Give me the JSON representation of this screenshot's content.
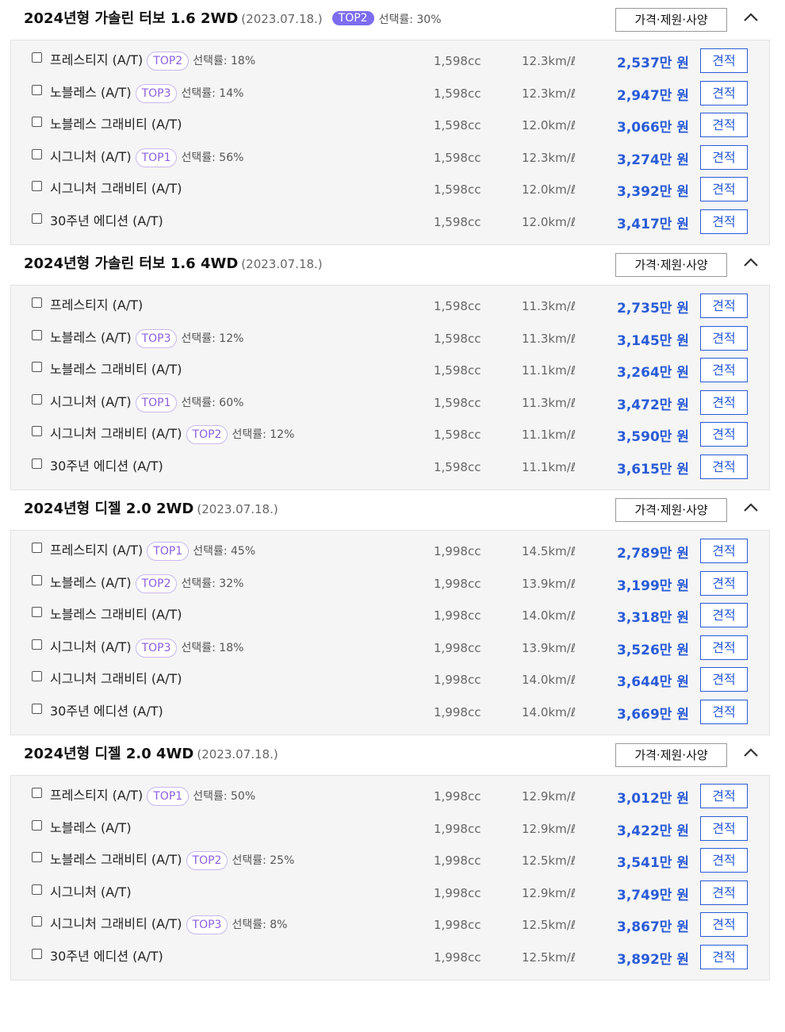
{
  "ui": {
    "spec_label": "가격·제원·사양",
    "quote_label": "견적",
    "icons": {
      "collapse": "chevron-up-icon",
      "checkbox": "checkbox-icon"
    },
    "colors": {
      "price": "#2a5bd7",
      "badge": "#8c5fe0",
      "top_badge_fill": "#7b6cf0"
    }
  },
  "groups": [
    {
      "title": "2024년형 가솔린 터보 1.6 2WD",
      "date": "(2023.07.18.)",
      "top": "TOP2",
      "rate": "선택률: 30%",
      "rows": [
        {
          "name": "프레스티지 (A/T)",
          "top": "TOP2",
          "rate": "선택률: 18%",
          "cc": "1,598cc",
          "eff": "12.3km/ℓ",
          "price": "2,537만 원"
        },
        {
          "name": "노블레스 (A/T)",
          "top": "TOP3",
          "rate": "선택률: 14%",
          "cc": "1,598cc",
          "eff": "12.3km/ℓ",
          "price": "2,947만 원"
        },
        {
          "name": "노블레스 그래비티 (A/T)",
          "top": "",
          "rate": "",
          "cc": "1,598cc",
          "eff": "12.0km/ℓ",
          "price": "3,066만 원"
        },
        {
          "name": "시그니처 (A/T)",
          "top": "TOP1",
          "rate": "선택률: 56%",
          "cc": "1,598cc",
          "eff": "12.3km/ℓ",
          "price": "3,274만 원"
        },
        {
          "name": "시그니처 그래비티 (A/T)",
          "top": "",
          "rate": "",
          "cc": "1,598cc",
          "eff": "12.0km/ℓ",
          "price": "3,392만 원"
        },
        {
          "name": "30주년 에디션 (A/T)",
          "top": "",
          "rate": "",
          "cc": "1,598cc",
          "eff": "12.0km/ℓ",
          "price": "3,417만 원"
        }
      ]
    },
    {
      "title": "2024년형 가솔린 터보 1.6 4WD",
      "date": "(2023.07.18.)",
      "top": "",
      "rate": "",
      "rows": [
        {
          "name": "프레스티지 (A/T)",
          "top": "",
          "rate": "",
          "cc": "1,598cc",
          "eff": "11.3km/ℓ",
          "price": "2,735만 원"
        },
        {
          "name": "노블레스 (A/T)",
          "top": "TOP3",
          "rate": "선택률: 12%",
          "cc": "1,598cc",
          "eff": "11.3km/ℓ",
          "price": "3,145만 원"
        },
        {
          "name": "노블레스 그래비티 (A/T)",
          "top": "",
          "rate": "",
          "cc": "1,598cc",
          "eff": "11.1km/ℓ",
          "price": "3,264만 원"
        },
        {
          "name": "시그니처 (A/T)",
          "top": "TOP1",
          "rate": "선택률: 60%",
          "cc": "1,598cc",
          "eff": "11.3km/ℓ",
          "price": "3,472만 원"
        },
        {
          "name": "시그니처 그래비티 (A/T)",
          "top": "TOP2",
          "rate": "선택률: 12%",
          "cc": "1,598cc",
          "eff": "11.1km/ℓ",
          "price": "3,590만 원"
        },
        {
          "name": "30주년 에디션 (A/T)",
          "top": "",
          "rate": "",
          "cc": "1,598cc",
          "eff": "11.1km/ℓ",
          "price": "3,615만 원"
        }
      ]
    },
    {
      "title": "2024년형 디젤 2.0 2WD",
      "date": "(2023.07.18.)",
      "top": "",
      "rate": "",
      "rows": [
        {
          "name": "프레스티지 (A/T)",
          "top": "TOP1",
          "rate": "선택률: 45%",
          "cc": "1,998cc",
          "eff": "14.5km/ℓ",
          "price": "2,789만 원"
        },
        {
          "name": "노블레스 (A/T)",
          "top": "TOP2",
          "rate": "선택률: 32%",
          "cc": "1,998cc",
          "eff": "13.9km/ℓ",
          "price": "3,199만 원"
        },
        {
          "name": "노블레스 그래비티 (A/T)",
          "top": "",
          "rate": "",
          "cc": "1,998cc",
          "eff": "14.0km/ℓ",
          "price": "3,318만 원"
        },
        {
          "name": "시그니처 (A/T)",
          "top": "TOP3",
          "rate": "선택률: 18%",
          "cc": "1,998cc",
          "eff": "13.9km/ℓ",
          "price": "3,526만 원"
        },
        {
          "name": "시그니처 그래비티 (A/T)",
          "top": "",
          "rate": "",
          "cc": "1,998cc",
          "eff": "14.0km/ℓ",
          "price": "3,644만 원"
        },
        {
          "name": "30주년 에디션 (A/T)",
          "top": "",
          "rate": "",
          "cc": "1,998cc",
          "eff": "14.0km/ℓ",
          "price": "3,669만 원"
        }
      ]
    },
    {
      "title": "2024년형 디젤 2.0 4WD",
      "date": "(2023.07.18.)",
      "top": "",
      "rate": "",
      "rows": [
        {
          "name": "프레스티지 (A/T)",
          "top": "TOP1",
          "rate": "선택률: 50%",
          "cc": "1,998cc",
          "eff": "12.9km/ℓ",
          "price": "3,012만 원"
        },
        {
          "name": "노블레스 (A/T)",
          "top": "",
          "rate": "",
          "cc": "1,998cc",
          "eff": "12.9km/ℓ",
          "price": "3,422만 원"
        },
        {
          "name": "노블레스 그래비티 (A/T)",
          "top": "TOP2",
          "rate": "선택률: 25%",
          "cc": "1,998cc",
          "eff": "12.5km/ℓ",
          "price": "3,541만 원"
        },
        {
          "name": "시그니처 (A/T)",
          "top": "",
          "rate": "",
          "cc": "1,998cc",
          "eff": "12.9km/ℓ",
          "price": "3,749만 원"
        },
        {
          "name": "시그니처 그래비티 (A/T)",
          "top": "TOP3",
          "rate": "선택률: 8%",
          "cc": "1,998cc",
          "eff": "12.5km/ℓ",
          "price": "3,867만 원"
        },
        {
          "name": "30주년 에디션 (A/T)",
          "top": "",
          "rate": "",
          "cc": "1,998cc",
          "eff": "12.5km/ℓ",
          "price": "3,892만 원"
        }
      ]
    }
  ]
}
